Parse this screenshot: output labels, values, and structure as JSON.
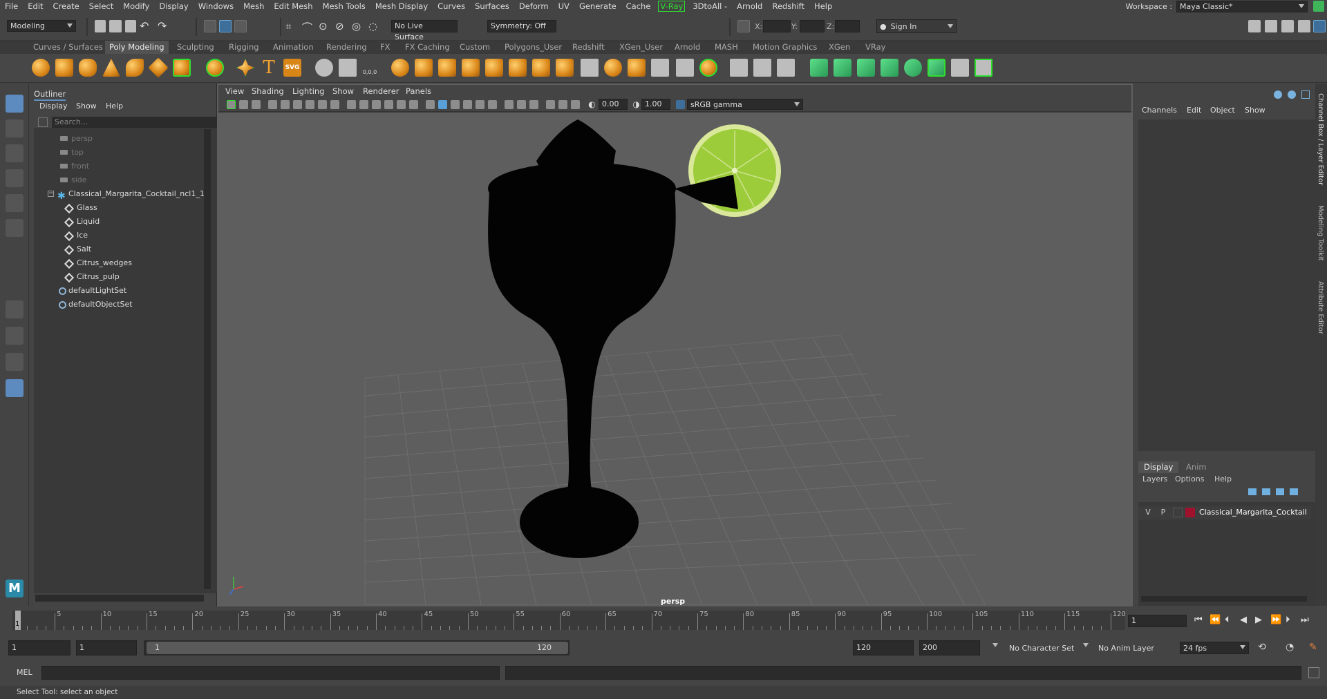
{
  "menubar": {
    "items": [
      "File",
      "Edit",
      "Create",
      "Select",
      "Modify",
      "Display",
      "Windows",
      "Mesh",
      "Edit Mesh",
      "Mesh Tools",
      "Mesh Display",
      "Curves",
      "Surfaces",
      "Deform",
      "UV",
      "Generate",
      "Cache"
    ],
    "vray": "V-Ray",
    "items2": [
      "3DtoAll -",
      "Arnold",
      "Redshift",
      "Help"
    ],
    "workspace_label": "Workspace :",
    "workspace_value": "Maya Classic*"
  },
  "statusline": {
    "mode": "Modeling",
    "live_surface": "No Live Surface",
    "symmetry": "Symmetry: Off",
    "x_label": "X:",
    "y_label": "Y:",
    "z_label": "Z:",
    "sign_in": "Sign In"
  },
  "shelf": {
    "tabs": [
      "Curves / Surfaces",
      "Poly Modeling",
      "Sculpting",
      "Rigging",
      "Animation",
      "Rendering",
      "FX",
      "FX Caching",
      "Custom",
      "Polygons_User",
      "Redshift",
      "XGen_User",
      "Arnold",
      "MASH",
      "Motion Graphics",
      "XGen",
      "VRay"
    ],
    "active_tab": "Poly Modeling",
    "text_icon": "T",
    "svg_icon": "SVG",
    "coord_icon": "0,0,0"
  },
  "outliner": {
    "title": "Outliner",
    "menu": [
      "Display",
      "Show",
      "Help"
    ],
    "search_placeholder": "Search...",
    "cameras": [
      "persp",
      "top",
      "front",
      "side"
    ],
    "group": "Classical_Margarita_Cocktail_ncl1_1",
    "children": [
      "Glass",
      "Liquid",
      "Ice",
      "Salt",
      "Citrus_wedges",
      "Citrus_pulp"
    ],
    "sets": [
      "defaultLightSet",
      "defaultObjectSet"
    ]
  },
  "viewport": {
    "menu": [
      "View",
      "Shading",
      "Lighting",
      "Show",
      "Renderer",
      "Panels"
    ],
    "exposure": "0.00",
    "gamma": "1.00",
    "colorspace": "sRGB gamma",
    "camera_label": "persp"
  },
  "channelbox": {
    "menu": [
      "Channels",
      "Edit",
      "Object",
      "Show"
    ],
    "layer_tabs": [
      "Display",
      "Anim"
    ],
    "layer_menu": [
      "Layers",
      "Options",
      "Help"
    ],
    "layer_v": "V",
    "layer_p": "P",
    "layer_name": "Classical_Margarita_Cocktail",
    "layer_color": "#a0112e",
    "side_tabs": [
      "Channel Box / Layer Editor",
      "Modeling Toolkit",
      "Attribute Editor"
    ]
  },
  "timeline": {
    "ticks": [
      "5",
      "10",
      "15",
      "20",
      "25",
      "30",
      "35",
      "40",
      "45",
      "50",
      "55",
      "60",
      "65",
      "70",
      "75",
      "80",
      "85",
      "90",
      "95",
      "100",
      "105",
      "110",
      "115",
      "120"
    ],
    "start_marker": "1",
    "current_frame": "1"
  },
  "range": {
    "start": "1",
    "playback_start": "1",
    "slider_start": "1",
    "slider_end": "120",
    "playback_end": "120",
    "end": "200",
    "character_set": "No Character Set",
    "anim_layer": "No Anim Layer",
    "fps": "24 fps"
  },
  "cmdline": {
    "label": "MEL"
  },
  "helpline": {
    "text": "Select Tool: select an object"
  },
  "colors": {
    "accent": "#5e8fc0",
    "vray": "#2fe02f",
    "lime": "#9ccc3a"
  }
}
